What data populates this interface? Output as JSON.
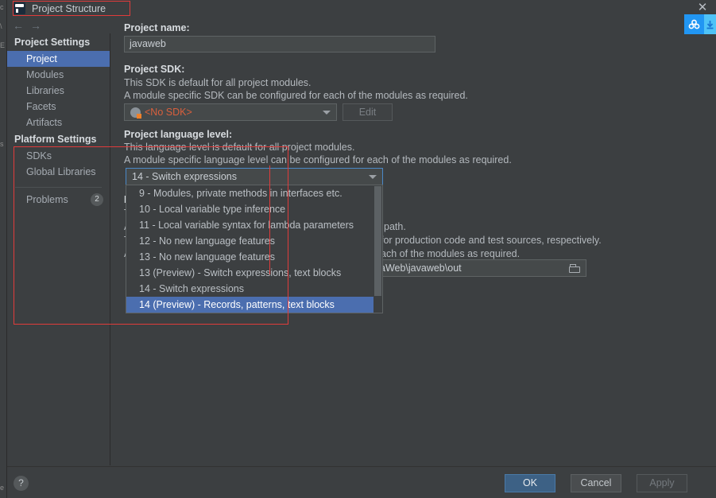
{
  "window": {
    "title": "Project Structure",
    "logo_icon": "intellij-idea-logo-icon",
    "close_icon": "close-icon",
    "nav_back_icon": "arrow-left-icon",
    "nav_forward_icon": "arrow-right-icon",
    "cloud_badge_icon": "cloud-sync-icon",
    "cloud_badge_secondary_icon": "download-arrow-icon"
  },
  "ide_sliver": {
    "glyphs": [
      "c",
      "\\",
      "E",
      "",
      "",
      "",
      "",
      "",
      "s",
      "",
      "",
      "",
      "e"
    ]
  },
  "sidebar": {
    "groups": [
      {
        "header": "Project Settings",
        "items": [
          {
            "label": "Project",
            "selected": true
          },
          {
            "label": "Modules",
            "selected": false
          },
          {
            "label": "Libraries",
            "selected": false
          },
          {
            "label": "Facets",
            "selected": false
          },
          {
            "label": "Artifacts",
            "selected": false
          }
        ]
      },
      {
        "header": "Platform Settings",
        "items": [
          {
            "label": "SDKs",
            "selected": false
          },
          {
            "label": "Global Libraries",
            "selected": false
          }
        ]
      }
    ],
    "problems": {
      "label": "Problems",
      "count": "2"
    }
  },
  "main": {
    "project_name": {
      "label": "Project name:",
      "value": "javaweb"
    },
    "project_sdk": {
      "label": "Project SDK:",
      "desc1": "This SDK is default for all project modules.",
      "desc2": "A module specific SDK can be configured for each of the modules as required.",
      "value": "<No SDK>",
      "sdk_icon": "sdk-warning-icon",
      "edit_button": "Edit"
    },
    "language_level": {
      "label": "Project language level:",
      "desc1": "This language level is default for all project modules.",
      "desc2": "A module specific language level can be configured for each of the modules as required.",
      "value": "14 - Switch expressions",
      "caret_icon": "chevron-down-icon"
    },
    "compiler_output": {
      "desc_tail_1": "path.",
      "desc_tail_2": "for production code and test sources, respectively.",
      "desc_tail_3": "ach of the modules as required.",
      "path_value": "aWeb\\javaweb\\out",
      "browse_icon": "folder-icon"
    },
    "obscured_left_glyphs": [
      "P",
      "T",
      "A",
      "T",
      "A"
    ]
  },
  "dropdown": {
    "options": [
      {
        "label": "9 - Modules, private methods in interfaces etc.",
        "selected": false
      },
      {
        "label": "10 - Local variable type inference",
        "selected": false
      },
      {
        "label": "11 - Local variable syntax for lambda parameters",
        "selected": false
      },
      {
        "label": "12 - No new language features",
        "selected": false
      },
      {
        "label": "13 - No new language features",
        "selected": false
      },
      {
        "label": "13 (Preview) - Switch expressions, text blocks",
        "selected": false
      },
      {
        "label": "14 - Switch expressions",
        "selected": false
      },
      {
        "label": "14 (Preview) - Records, patterns, text blocks",
        "selected": true
      }
    ],
    "scrollbar": "vertical-scrollbar"
  },
  "footer": {
    "help_label": "?",
    "ok_label": "OK",
    "cancel_label": "Cancel",
    "apply_label": "Apply"
  },
  "colors": {
    "accent_selection": "#4b6eaf",
    "annotation_red": "#e03b3b",
    "sdk_warning_text": "#d9603d",
    "ok_button": "#3d6185",
    "panel_bg": "#3c3f41",
    "field_bg": "#45494a"
  }
}
